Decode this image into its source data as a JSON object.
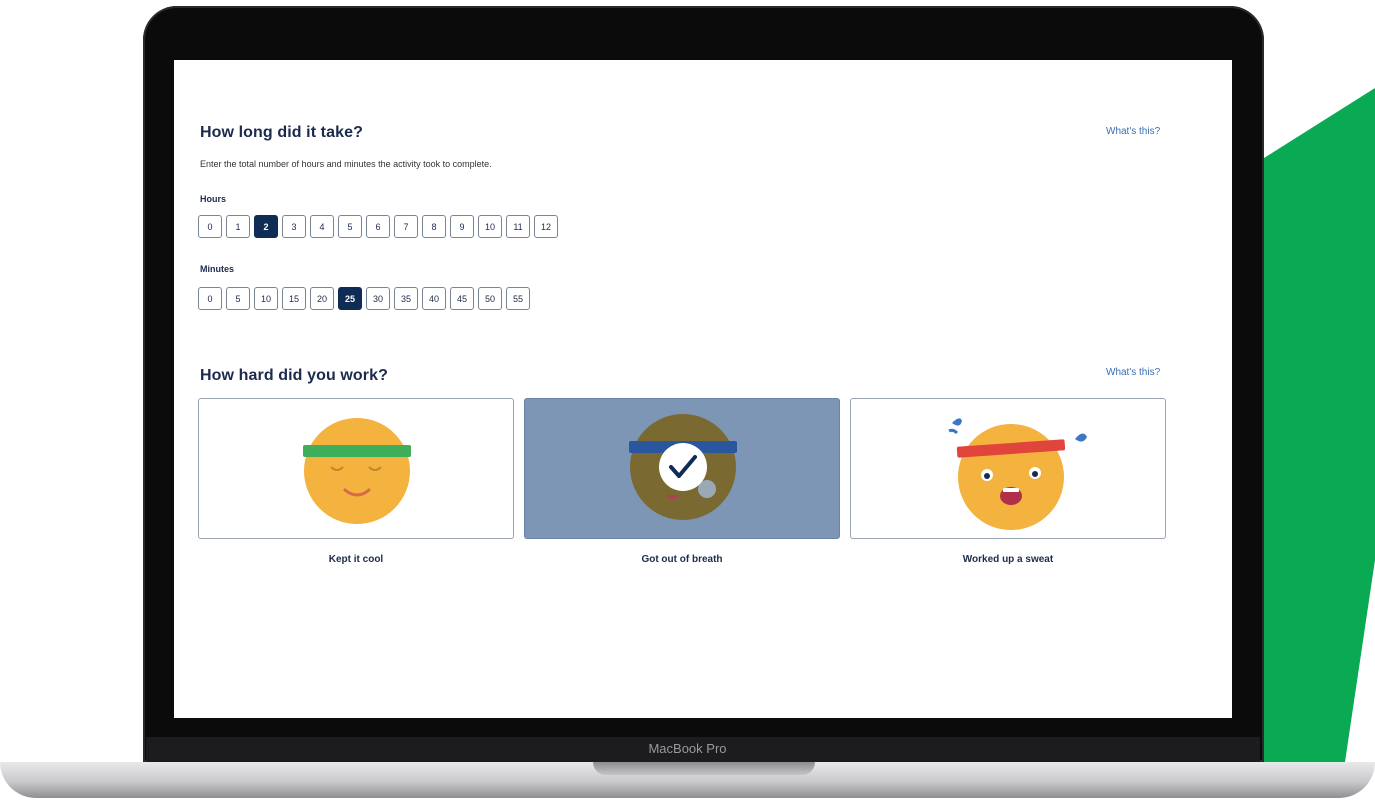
{
  "device": {
    "model_label": "MacBook Pro"
  },
  "duration": {
    "title": "How long did it take?",
    "help_link": "What's this?",
    "description": "Enter the total number of hours and minutes the activity took to complete.",
    "hours": {
      "label": "Hours",
      "options": [
        "0",
        "1",
        "2",
        "3",
        "4",
        "5",
        "6",
        "7",
        "8",
        "9",
        "10",
        "11",
        "12"
      ],
      "selected": "2"
    },
    "minutes": {
      "label": "Minutes",
      "options": [
        "0",
        "5",
        "10",
        "15",
        "20",
        "25",
        "30",
        "35",
        "40",
        "45",
        "50",
        "55"
      ],
      "selected": "25"
    }
  },
  "effort": {
    "title": "How hard did you work?",
    "help_link": "What's this?",
    "options": [
      {
        "label": "Kept it cool",
        "icon": "calm-face-icon",
        "selected": false
      },
      {
        "label": "Got out of breath",
        "icon": "breathless-face-icon",
        "selected": true
      },
      {
        "label": "Worked up a sweat",
        "icon": "sweating-face-icon",
        "selected": false
      }
    ]
  },
  "colors": {
    "brand_green": "#0aaa55",
    "selected_navy": "#0f2c55",
    "selected_card": "#7d96b6",
    "heading": "#1c2a4d",
    "link": "#3b6fb0",
    "face": "#f4b23e"
  }
}
